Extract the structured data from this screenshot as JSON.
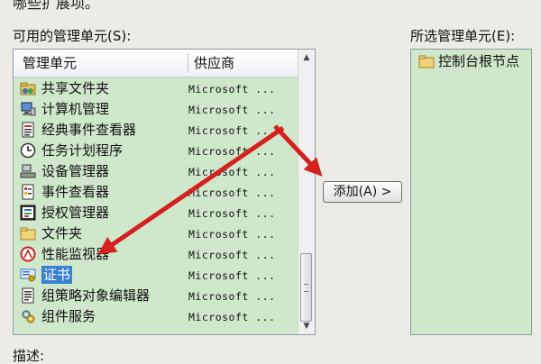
{
  "intro_text": "哪些扩展项。",
  "available": {
    "label": "可用的管理单元(S):",
    "header": {
      "name": "管理单元",
      "vendor": "供应商"
    },
    "items": [
      {
        "name": "共享文件夹",
        "vendor": "Microsoft ...",
        "icon": "shared-folder-icon"
      },
      {
        "name": "计算机管理",
        "vendor": "Microsoft ...",
        "icon": "computer-management-icon"
      },
      {
        "name": "经典事件查看器",
        "vendor": "Microsoft ...",
        "icon": "classic-event-viewer-icon"
      },
      {
        "name": "任务计划程序",
        "vendor": "Microsoft ...",
        "icon": "task-scheduler-icon"
      },
      {
        "name": "设备管理器",
        "vendor": "Microsoft ...",
        "icon": "device-manager-icon"
      },
      {
        "name": "事件查看器",
        "vendor": "Microsoft ...",
        "icon": "event-viewer-icon"
      },
      {
        "name": "授权管理器",
        "vendor": "Microsoft ...",
        "icon": "authorization-manager-icon"
      },
      {
        "name": "文件夹",
        "vendor": "Microsoft ...",
        "icon": "folder-icon"
      },
      {
        "name": "性能监视器",
        "vendor": "Microsoft ...",
        "icon": "performance-monitor-icon"
      },
      {
        "name": "证书",
        "vendor": "Microsoft ...",
        "icon": "certificate-icon",
        "selected": true
      },
      {
        "name": "组策略对象编辑器",
        "vendor": "Microsoft ...",
        "icon": "group-policy-editor-icon"
      },
      {
        "name": "组件服务",
        "vendor": "Microsoft ...",
        "icon": "component-services-icon"
      }
    ]
  },
  "add_button": {
    "label": "添加(A) >"
  },
  "selected": {
    "label": "所选管理单元(E):",
    "items": [
      {
        "name": "控制台根节点",
        "icon": "folder-icon"
      }
    ]
  },
  "description": {
    "label": "描述:"
  },
  "colors": {
    "list_bg": "#cfe8cb",
    "selection": "#3a7fd0",
    "arrow": "#d42020"
  }
}
